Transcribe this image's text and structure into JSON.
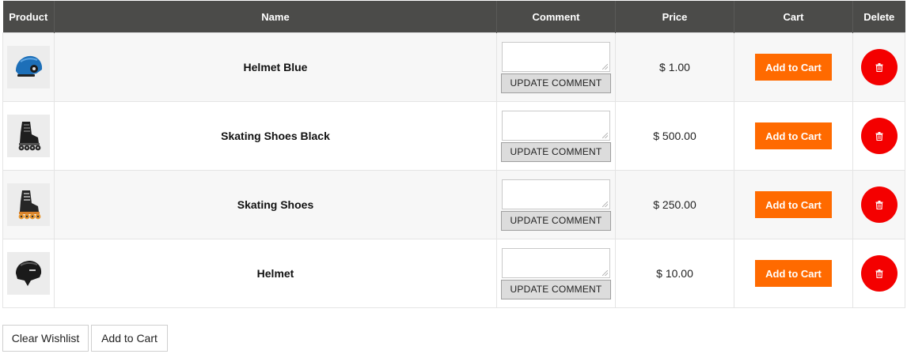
{
  "table": {
    "headers": {
      "product": "Product",
      "name": "Name",
      "comment": "Comment",
      "price": "Price",
      "cart": "Cart",
      "delete": "Delete"
    },
    "rows": [
      {
        "image_icon": "blue-helmet-icon",
        "name": "Helmet Blue",
        "comment": "",
        "update_label": "UPDATE COMMENT",
        "price": "$ 1.00",
        "cart_label": "Add to Cart",
        "delete_icon": "trash-icon"
      },
      {
        "image_icon": "black-skate-icon",
        "name": "Skating Shoes Black",
        "comment": "",
        "update_label": "UPDATE COMMENT",
        "price": "$ 500.00",
        "cart_label": "Add to Cart",
        "delete_icon": "trash-icon"
      },
      {
        "image_icon": "orange-skate-icon",
        "name": "Skating Shoes",
        "comment": "",
        "update_label": "UPDATE COMMENT",
        "price": "$ 250.00",
        "cart_label": "Add to Cart",
        "delete_icon": "trash-icon"
      },
      {
        "image_icon": "black-helmet-icon",
        "name": "Helmet",
        "comment": "",
        "update_label": "UPDATE COMMENT",
        "price": "$ 10.00",
        "cart_label": "Add to Cart",
        "delete_icon": "trash-icon"
      }
    ]
  },
  "actions": {
    "clear_label": "Clear Wishlist",
    "add_all_label": "Add to Cart"
  },
  "colors": {
    "header_bg": "#4b4b49",
    "cart_button": "#ff6a00",
    "delete_button": "#f40000",
    "row_alt": "#f7f7f7"
  }
}
